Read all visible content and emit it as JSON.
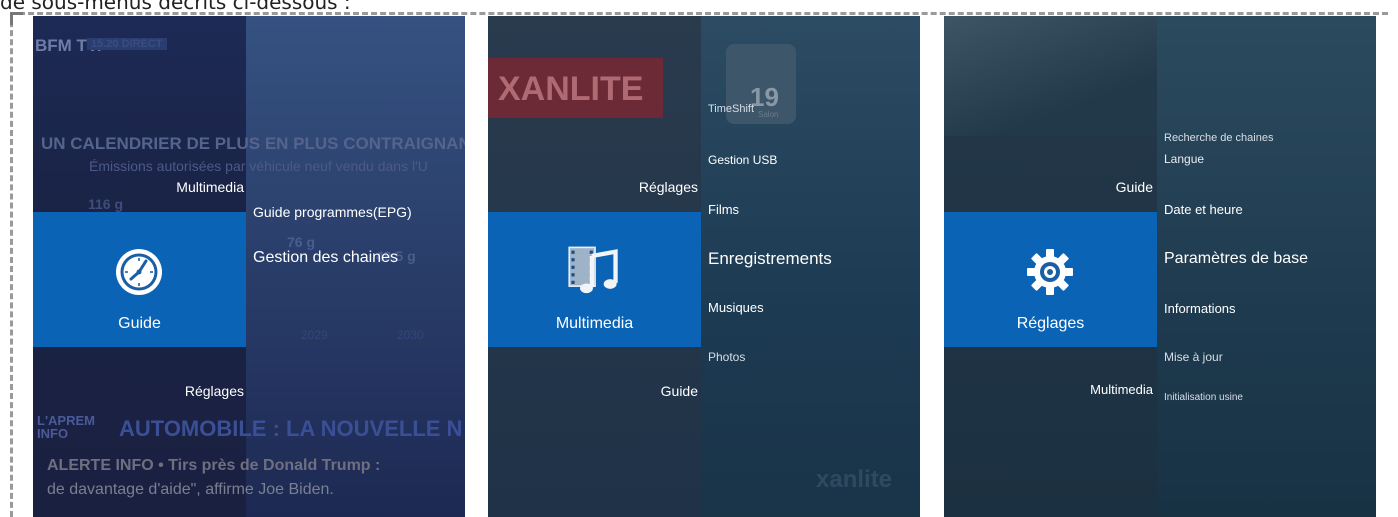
{
  "caption": "de sous-menus décrits ci-dessous :",
  "colors": {
    "tile_blue": "#0a63b5",
    "text": "#ffffff"
  },
  "panel1": {
    "bg": {
      "channel": "BFM TV.",
      "badge": "15.20 DIRECT",
      "headline": "UN CALENDRIER DE PLUS EN PLUS CONTRAIGNANT",
      "subhead": "Émissions autorisées par véhicule neuf vendu dans l'U",
      "values": [
        "116 g",
        "76 g",
        "49,5 g"
      ],
      "years": [
        "2029",
        "2030"
      ],
      "show": "L'APREM INFO",
      "banner": "AUTOMOBILE : LA NOUVELLE N",
      "alert": "ALERTE INFO • Tirs près de Donald Trump :",
      "alert2": "de davantage d'aide\", affirme Joe Biden."
    },
    "prev_label": "Multimedia",
    "tile_label": "Guide",
    "icon": "clock-icon",
    "next_label": "Réglages",
    "submenu": [
      "Guide programmes(EPG)",
      "Gestion des chaines"
    ]
  },
  "panel2": {
    "bg": {
      "brand": "XANLITE",
      "weather": "19",
      "city": "Salon",
      "footer_brand": "xanlite"
    },
    "prev_label": "Réglages",
    "tile_label": "Multimedia",
    "icon": "film-music-icon",
    "next_label": "Guide",
    "submenu": [
      "TimeShift",
      "Gestion USB",
      "Films",
      "Enregistrements",
      "Musiques",
      "Photos"
    ]
  },
  "panel3": {
    "prev_label": "Guide",
    "tile_label": "Réglages",
    "icon": "gear-icon",
    "next_label": "Multimedia",
    "submenu": [
      "Recherche de chaines",
      "Langue",
      "Date et heure",
      "Paramètres de base",
      "Informations",
      "Mise à jour",
      "Initialisation usine"
    ]
  }
}
